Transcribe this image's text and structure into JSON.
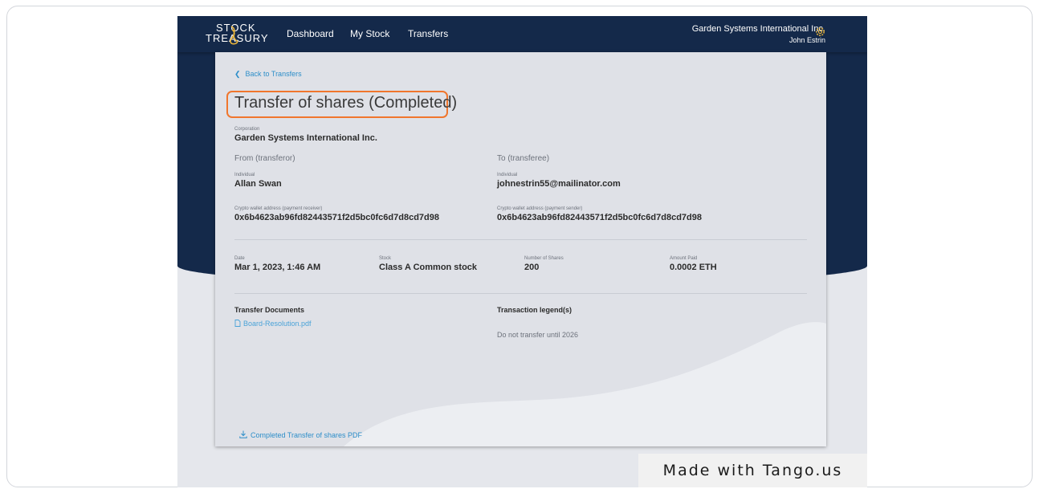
{
  "brand": {
    "line1": "STOCK",
    "line2": "TREASURY"
  },
  "nav": {
    "dashboard": "Dashboard",
    "my_stock": "My Stock",
    "transfers": "Transfers"
  },
  "account": {
    "organization": "Garden Systems International Inc.",
    "user": "John Estrin",
    "icon": "gear-icon"
  },
  "back_link": "Back to Transfers",
  "page_title": "Transfer of shares (Completed)",
  "corporation": {
    "label": "Corporation",
    "value": "Garden Systems International Inc."
  },
  "from": {
    "heading": "From (transferor)",
    "type_label": "Individual",
    "name": "Allan Swan",
    "wallet_label": "Crypto wallet address (payment receiver)",
    "wallet": "0x6b4623ab96fd82443571f2d5bc0fc6d7d8cd7d98"
  },
  "to": {
    "heading": "To (transferee)",
    "type_label": "Individual",
    "name": "johnestrin55@mailinator.com",
    "wallet_label": "Crypto wallet address (payment sender)",
    "wallet": "0x6b4623ab96fd82443571f2d5bc0fc6d7d8cd7d98"
  },
  "details": {
    "date_label": "Date",
    "date": "Mar 1, 2023, 1:46 AM",
    "stock_label": "Stock",
    "stock": "Class A Common stock",
    "shares_label": "Number of Shares",
    "shares": "200",
    "paid_label": "Amount Paid",
    "paid": "0.0002 ETH"
  },
  "documents": {
    "heading": "Transfer Documents",
    "files": [
      "Board-Resolution.pdf"
    ]
  },
  "legends": {
    "heading": "Transaction legend(s)",
    "items": [
      "Do not transfer until 2026"
    ]
  },
  "download_link": "Completed Transfer of shares PDF",
  "watermark": "Made with Tango.us",
  "colors": {
    "navy": "#14294a",
    "card": "#dfe1e7",
    "link": "#2d8ec9",
    "highlight": "#f0762d"
  }
}
